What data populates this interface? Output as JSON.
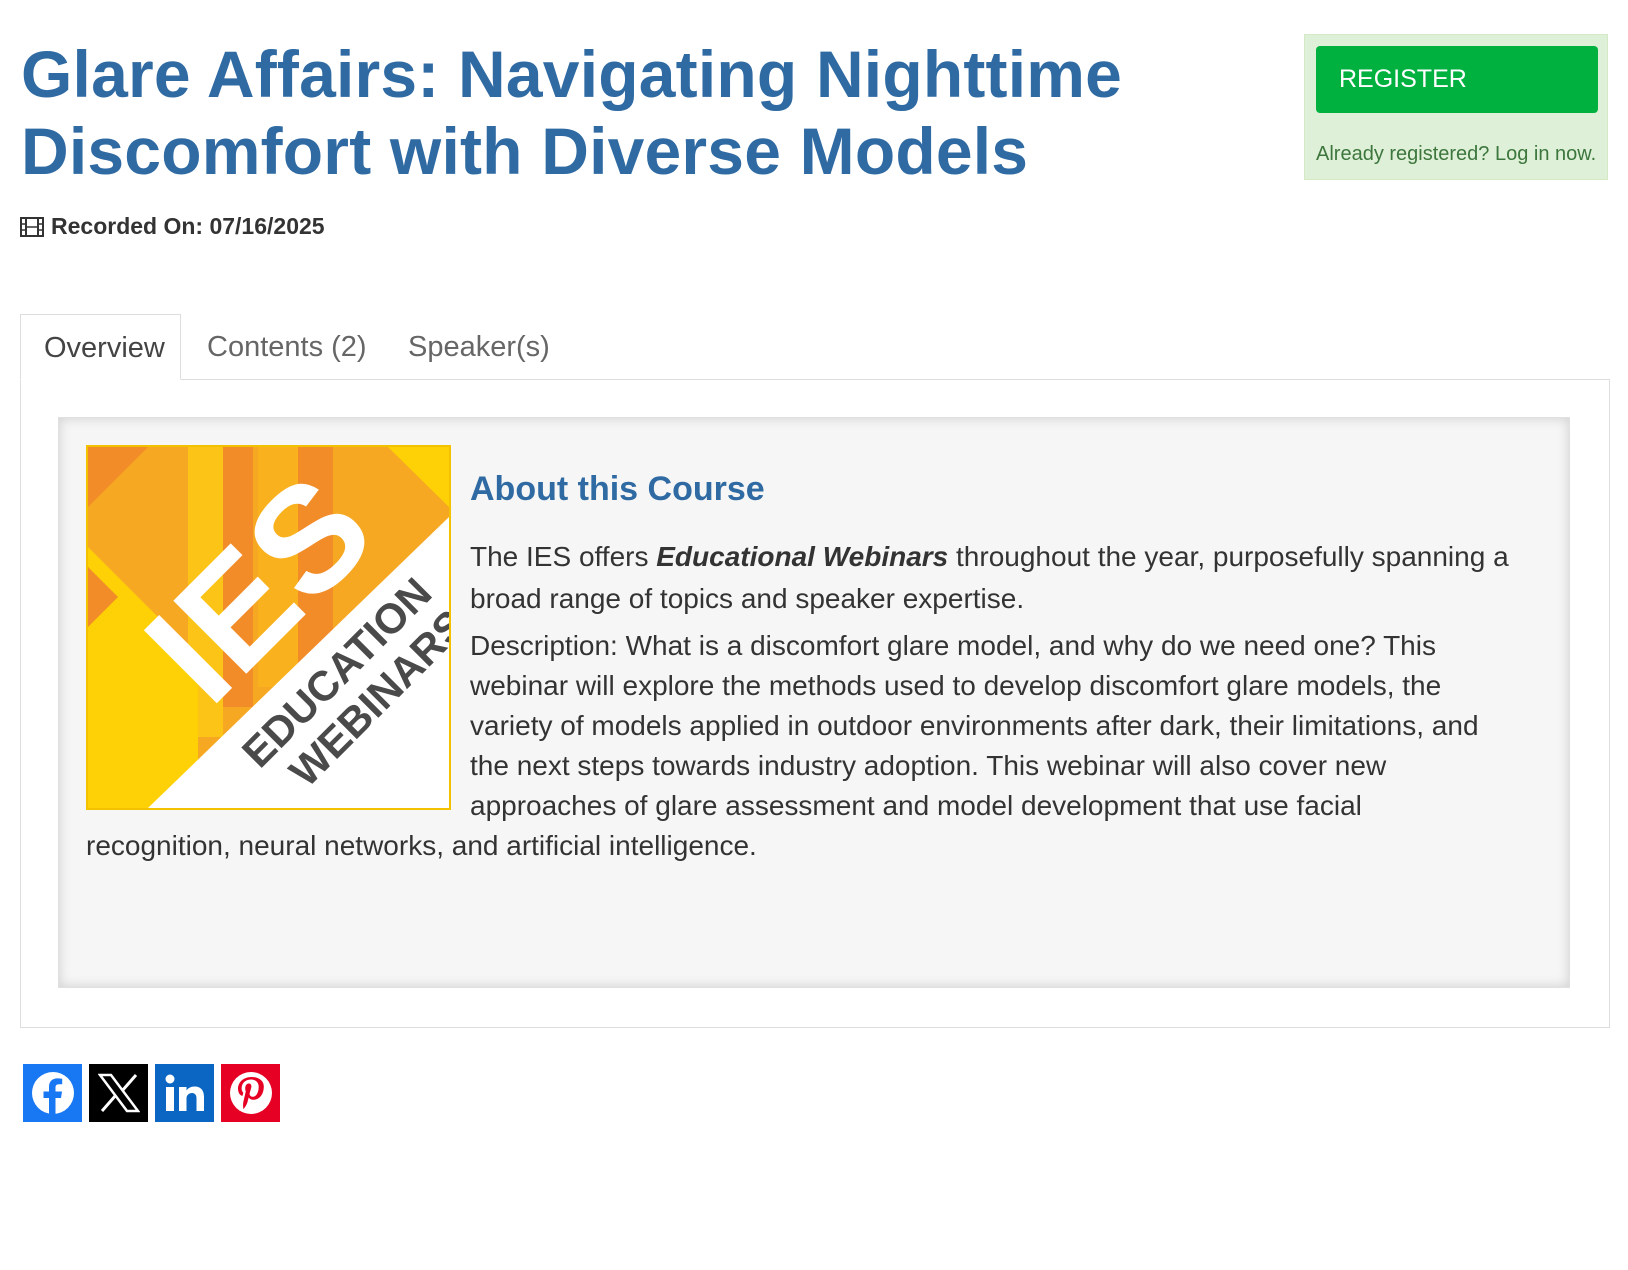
{
  "page": {
    "title": "Glare Affairs: Navigating Nighttime Discomfort with Diverse Models",
    "recorded_label": "Recorded On: 07/16/2025"
  },
  "register": {
    "button_label": "REGISTER",
    "already_text": "Already registered?",
    "login_link": "Log in now."
  },
  "tabs": [
    {
      "label": "Overview",
      "active": true
    },
    {
      "label": "Contents (2)",
      "active": false
    },
    {
      "label": "Speaker(s)",
      "active": false
    }
  ],
  "overview": {
    "logo_text": "IES",
    "logo_line1": "EDUCATION",
    "logo_line2": "WEBINARS",
    "heading": "About this Course",
    "intro_prefix": "The IES offers ",
    "intro_bold": "Educational Webinars",
    "intro_suffix": " throughout the year, purposefully spanning a broad range of topics and speaker expertise.",
    "description_lines": [
      "Description:  What is a discomfort glare model, and why do we need one? This",
      "webinar will explore the methods used to develop discomfort glare models, the",
      "variety of models applied in outdoor environments after dark, their limitations, and",
      "the next steps towards industry adoption. This webinar will also cover new",
      "approaches of glare assessment and model development that use facial",
      "recognition, neural networks, and artificial intelligence."
    ]
  },
  "social": [
    {
      "name": "facebook",
      "icon": "facebook-icon",
      "color": "#1877f2"
    },
    {
      "name": "x",
      "icon": "x-icon",
      "color": "#000000"
    },
    {
      "name": "linkedin",
      "icon": "linkedin-icon",
      "color": "#0a66c2"
    },
    {
      "name": "pinterest",
      "icon": "pinterest-icon",
      "color": "#e60023"
    }
  ],
  "colors": {
    "title_blue": "#2f6aa3",
    "register_green": "#00b140",
    "register_box_bg": "#dff0d8"
  }
}
